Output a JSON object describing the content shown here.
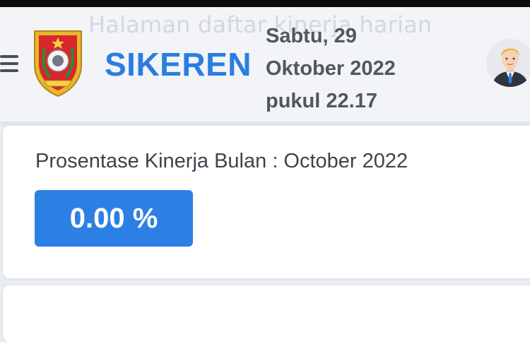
{
  "header": {
    "ghost_text": "Halaman daftar kinerja harian",
    "app_title": "SIKEREN",
    "date_line1": "Sabtu, 29",
    "date_line2": "Oktober 2022",
    "time_line": "pukul 22.17",
    "menu_icon": "hamburger-menu-icon",
    "logo": "regional-government-emblem",
    "avatar": "user-avatar"
  },
  "performance": {
    "title": "Prosentase Kinerja Bulan : October 2022",
    "value": "0.00 %"
  },
  "colors": {
    "brand_blue": "#2b7de0",
    "badge_blue": "#2d80e3",
    "text_gray": "#505761"
  }
}
